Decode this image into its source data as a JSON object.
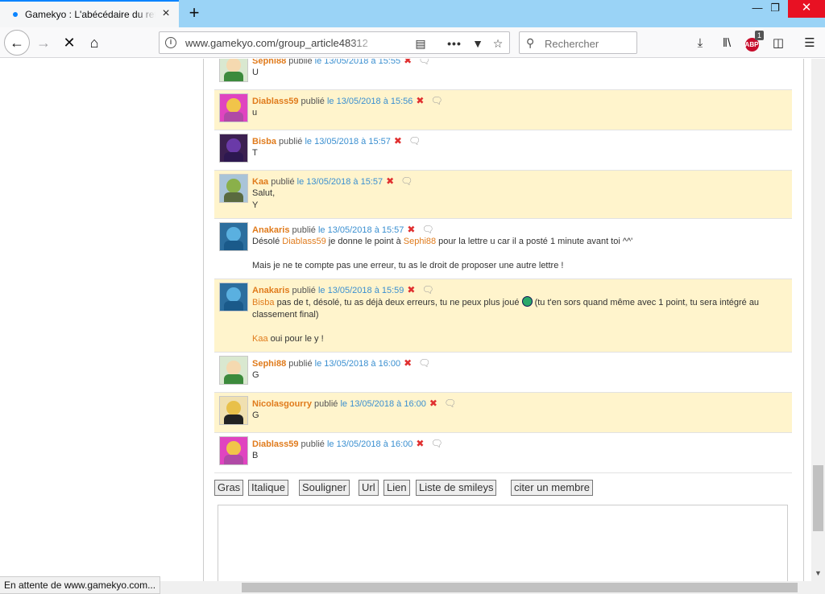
{
  "browser": {
    "tab_title": "Gamekyo : L'abécédaire du retr",
    "url": "www.gamekyo.com/group_article48312",
    "search_placeholder": "Rechercher",
    "abp_count": "1",
    "abp_label": "ABP",
    "status": "En attente de www.gamekyo.com..."
  },
  "comments": [
    {
      "author": "Sephi88",
      "published": "publié",
      "date": "le 13/05/2018 à 15:55",
      "alt": false,
      "avatar": "sephi",
      "lines": [
        "U"
      ]
    },
    {
      "author": "Diablass59",
      "published": "publié",
      "date": "le 13/05/2018 à 15:56",
      "alt": true,
      "avatar": "diablass",
      "lines": [
        "u"
      ]
    },
    {
      "author": "Bisba",
      "published": "publié",
      "date": "le 13/05/2018 à 15:57",
      "alt": false,
      "avatar": "bisba",
      "lines": [
        "T"
      ]
    },
    {
      "author": "Kaa",
      "published": "publié",
      "date": "le 13/05/2018 à 15:57",
      "alt": true,
      "avatar": "kaa",
      "lines": [
        "Salut,",
        "Y"
      ]
    },
    {
      "author": "Anakaris",
      "published": "publié",
      "date": "le 13/05/2018 à 15:57",
      "alt": false,
      "avatar": "anakaris",
      "rich": {
        "p1_a": "Désolé ",
        "p1_m1": "Diablass59",
        "p1_b": " je donne le point à ",
        "p1_m2": "Sephi88",
        "p1_c": " pour la lettre u car il a posté 1 minute avant toi ^^'",
        "p2": "Mais je ne te compte pas une erreur, tu as le droit de proposer une autre lettre !"
      }
    },
    {
      "author": "Anakaris",
      "published": "publié",
      "date": "le 13/05/2018 à 15:59",
      "alt": true,
      "avatar": "anakaris",
      "rich": {
        "p1_m1": "Bisba",
        "p1_a": " pas de t, désolé, tu as déjà deux erreurs, tu ne peux plus joué ",
        "p1_b": " (tu t'en sors quand même avec 1 point, tu sera intégré au classement final)",
        "p2_m": "Kaa",
        "p2": " oui pour le y !"
      }
    },
    {
      "author": "Sephi88",
      "published": "publié",
      "date": "le 13/05/2018 à 16:00",
      "alt": false,
      "avatar": "sephi",
      "lines": [
        "G"
      ]
    },
    {
      "author": "Nicolasgourry",
      "published": "publié",
      "date": "le 13/05/2018 à 16:00",
      "alt": true,
      "avatar": "nicolas",
      "lines": [
        "G"
      ]
    },
    {
      "author": "Diablass59",
      "published": "publié",
      "date": "le 13/05/2018 à 16:00",
      "alt": false,
      "avatar": "diablass",
      "lines": [
        "B"
      ]
    }
  ],
  "toolbar": {
    "bold": "Gras",
    "italic": "Italique",
    "underline": "Souligner",
    "url": "Url",
    "link": "Lien",
    "smileys": "Liste de smileys",
    "quote": "citer un membre"
  },
  "avatar_colors": {
    "sephi": [
      "#f5d9b0",
      "#3c8a3c",
      "#d9e8d0"
    ],
    "diablass": [
      "#f1c44a",
      "#b04aa6",
      "#e044c0"
    ],
    "bisba": [
      "#6a3aa8",
      "#2d1850",
      "#3b2050"
    ],
    "kaa": [
      "#8ab04a",
      "#5a6a40",
      "#a9c4d8"
    ],
    "anakaris": [
      "#5ab0e0",
      "#1a5a8a",
      "#2c6e9e"
    ],
    "nicolas": [
      "#e8c04a",
      "#222",
      "#f0e0b0"
    ]
  }
}
